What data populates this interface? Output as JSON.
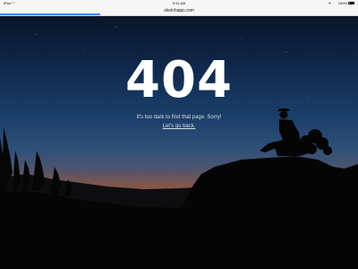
{
  "status_bar": {
    "carrier": "iPad",
    "wifi_icon": "wifi-icon",
    "time": "9:41 AM",
    "bluetooth_icon": "bluetooth-icon",
    "battery": "100%",
    "battery_icon": "battery-icon"
  },
  "browser": {
    "url": "sketchapp.com",
    "load_progress_fraction": 0.28,
    "progress_color": "#3b8cf1"
  },
  "error_page": {
    "code": "404",
    "message": "It's too dark to find that page. Sorry!",
    "back_link": "Let's go back."
  }
}
